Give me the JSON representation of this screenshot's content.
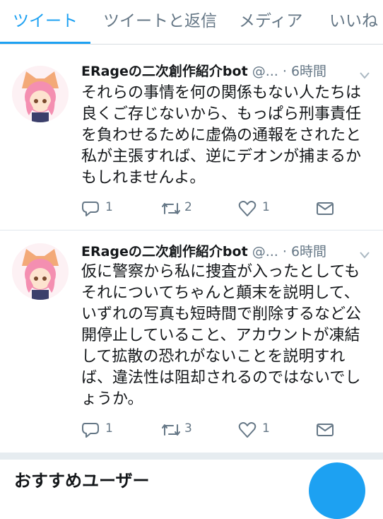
{
  "tabs": [
    "ツイート",
    "ツイートと返信",
    "メディア",
    "いいね"
  ],
  "active_tab_index": 0,
  "tweets": [
    {
      "name": "ERageの二次創作紹介bot",
      "handle": "@...",
      "dot": "·",
      "time": "6時間",
      "text": "それらの事情を何の関係もない人たちは\n良くご存じないから、もっぱら刑事責任\nを負わせるために虚偽の通報をされたと\n私が主張すれば、逆にデオンが捕まるか\nもしれませんよ。",
      "replies": "1",
      "retweets": "2",
      "likes": "1"
    },
    {
      "name": "ERageの二次創作紹介bot",
      "handle": "@...",
      "dot": "·",
      "time": "6時間",
      "text": "仮に警察から私に捜査が入ったとしても\nそれについてちゃんと顛末を説明して、\nいずれの写真も短時間で削除するなど公\n開停止していること、アカウントが凍結\nして拡散の恐れがないことを説明すれ\nば、違法性は阻却されるのではないでし\nょうか。",
      "replies": "1",
      "retweets": "3",
      "likes": "1"
    }
  ],
  "suggestions_title": "おすすめユーザー",
  "colors": {
    "accent": "#1da1f2",
    "text": "#14171a",
    "muted": "#657786",
    "separator": "#e1e8ed",
    "band": "#e6ecf0"
  },
  "icons": {
    "reply": "speech-bubble-icon",
    "retweet": "retweet-arrows-icon",
    "like": "heart-outline-icon",
    "dm": "envelope-icon",
    "caret": "chevron-down-icon"
  }
}
